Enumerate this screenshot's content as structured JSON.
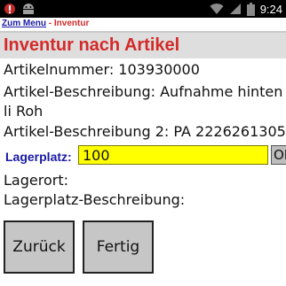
{
  "status_bar": {
    "time": "9:24",
    "icons": [
      "app-notification-icon",
      "android-notification-icon",
      "wifi-icon",
      "cellular-signal-icon",
      "battery-icon"
    ]
  },
  "breadcrumb": {
    "link": "Zum Menu",
    "separator": " - ",
    "current": "Inventur"
  },
  "page_title": "Inventur nach Artikel",
  "article": {
    "number_line": "Artikelnummer: 103930000",
    "description_line1": "Artikel-Beschreibung: Aufnahme hinten",
    "description_line2": "li Roh",
    "description2_line": "Artikel-Beschreibung 2: PA 2226261305"
  },
  "lagerplatz": {
    "label": "Lagerplatz:",
    "value": "100",
    "ok_label": "OK"
  },
  "lagerort_line": "Lagerort:",
  "lagerplatz_description_line": "Lagerplatz-Beschreibung:",
  "buttons": {
    "back": "Zurück",
    "finish": "Fertig"
  },
  "colors": {
    "title_red": "#d42a2a",
    "link_blue": "#1a1aa6",
    "input_yellow": "#ffff00"
  }
}
